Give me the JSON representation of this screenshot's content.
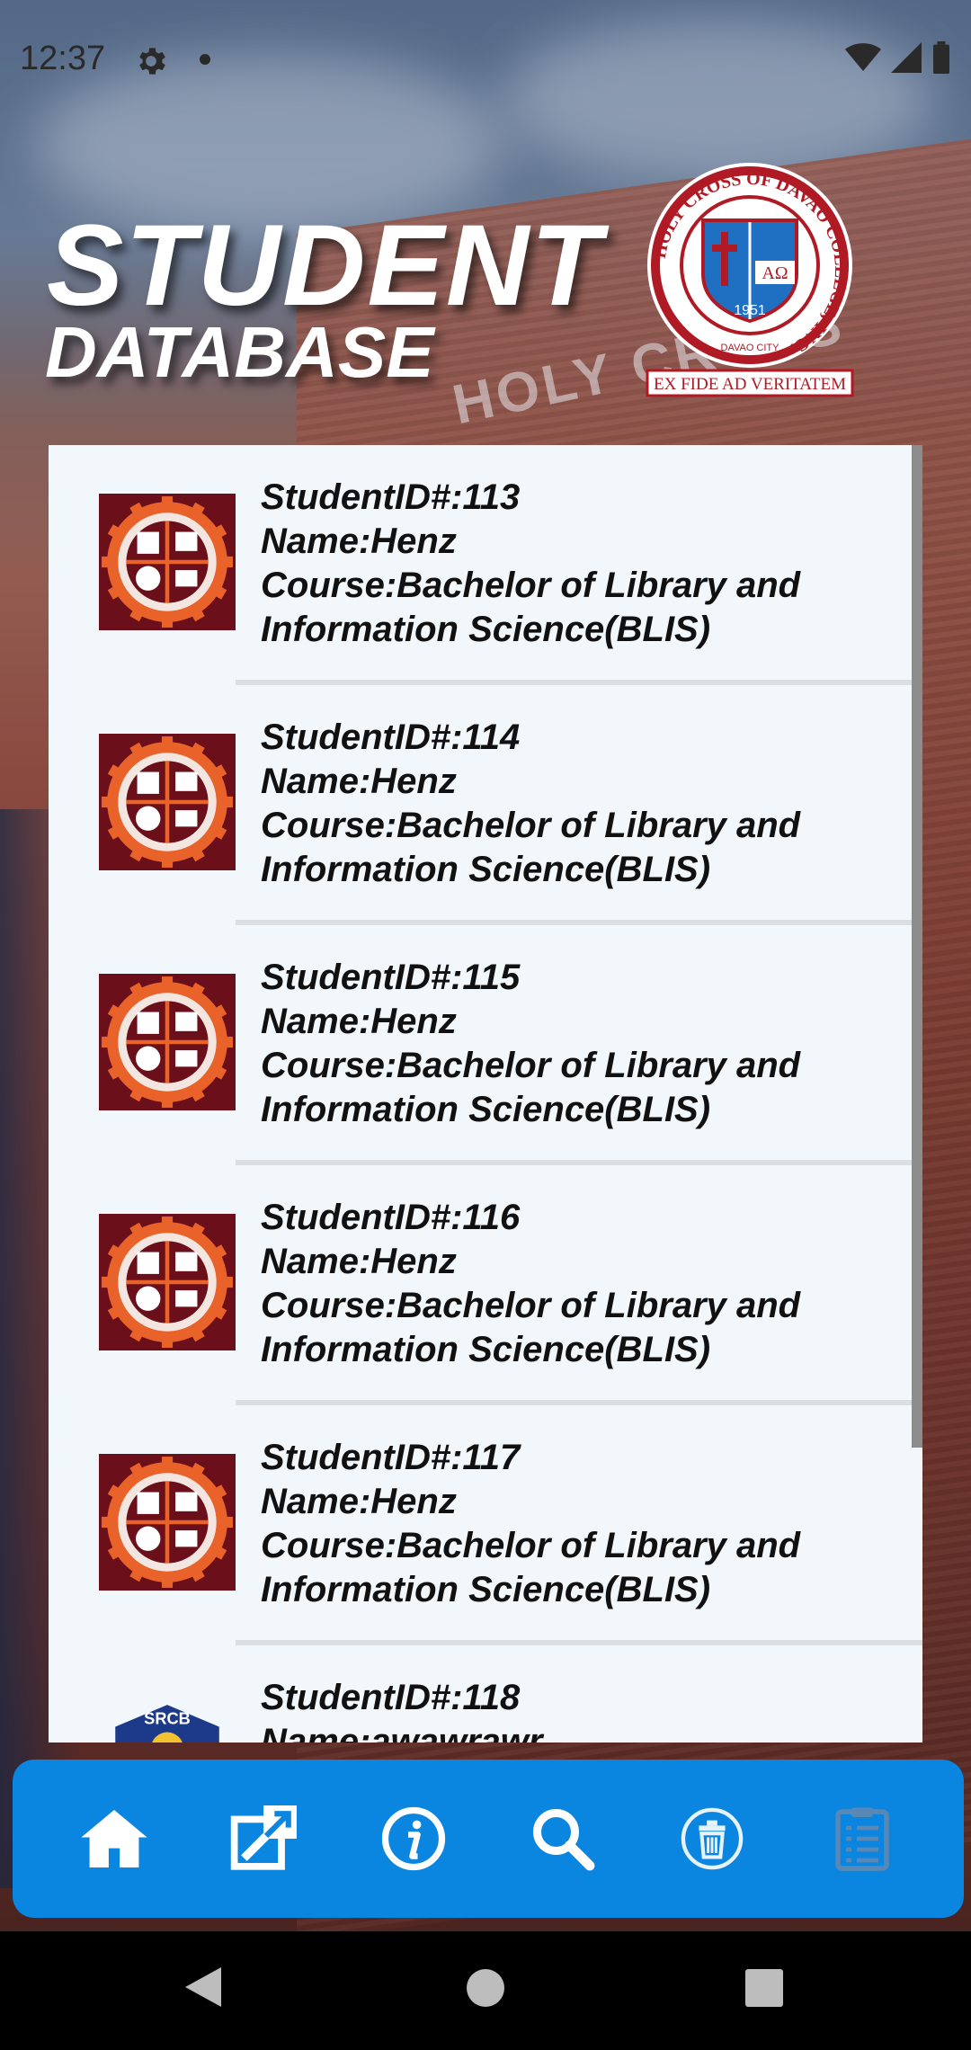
{
  "status_bar": {
    "time": "12:37",
    "icons": [
      "settings-icon",
      "notification-dot",
      "wifi-icon",
      "signal-icon",
      "battery-icon"
    ]
  },
  "header": {
    "title_line1": "STUDENT",
    "title_line2": "DATABASE",
    "seal": {
      "ring_text": "HOLY CROSS OF DAVAO COLLEGE, INC.",
      "year": "1951",
      "city": "DAVAO CITY",
      "motto": "EX FIDE AD VERITATEM"
    }
  },
  "students": [
    {
      "id_line": "StudentID#:113",
      "name_line": "Name:Henz",
      "course_line1": "Course:Bachelor of Library and",
      "course_line2": "Information Science(BLIS)",
      "logo": "org-logo"
    },
    {
      "id_line": "StudentID#:114",
      "name_line": "Name:Henz",
      "course_line1": "Course:Bachelor of Library and",
      "course_line2": "Information Science(BLIS)",
      "logo": "org-logo"
    },
    {
      "id_line": "StudentID#:115",
      "name_line": "Name:Henz",
      "course_line1": "Course:Bachelor of Library and",
      "course_line2": "Information Science(BLIS)",
      "logo": "org-logo"
    },
    {
      "id_line": "StudentID#:116",
      "name_line": "Name:Henz",
      "course_line1": "Course:Bachelor of Library and",
      "course_line2": "Information Science(BLIS)",
      "logo": "org-logo"
    },
    {
      "id_line": "StudentID#:117",
      "name_line": "Name:Henz",
      "course_line1": "Course:Bachelor of Library and",
      "course_line2": "Information Science(BLIS)",
      "logo": "org-logo"
    },
    {
      "id_line": "StudentID#:118",
      "name_line": "Name:awawrawr",
      "course_line1": "",
      "course_line2": "",
      "logo": "srcb-logo"
    }
  ],
  "bottom_nav": [
    "home-icon",
    "edit-icon",
    "info-icon",
    "search-icon",
    "delete-icon",
    "list-icon"
  ],
  "colors": {
    "nav_bar": "#0b86e0",
    "list_background": "#f2f7fb",
    "logo_maroon": "#7a1020",
    "logo_orange": "#e8622a"
  }
}
